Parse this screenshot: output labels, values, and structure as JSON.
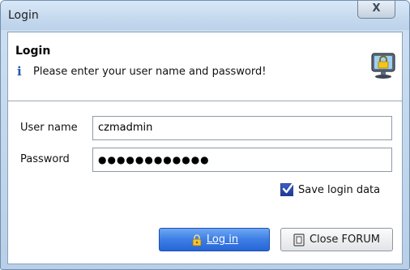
{
  "window": {
    "title": "Login",
    "close_label": "X"
  },
  "header": {
    "title": "Login",
    "info_text": "Please enter your user name and password!",
    "info_icon": "i"
  },
  "form": {
    "username_label": "User name",
    "username_value": "czmadmin",
    "password_label": "Password",
    "password_value": "●●●●●●●●●●●●",
    "save_label": "Save login data",
    "save_checked": true
  },
  "buttons": {
    "login_label": "Log in",
    "close_label": "Close FORUM"
  },
  "colors": {
    "accent": "#3d7ee6",
    "info_icon": "#2a56a8",
    "checkbox": "#1c3a97"
  },
  "icons": [
    "close-icon",
    "info-icon",
    "lock-monitor-icon",
    "check-icon",
    "lock-key-icon",
    "exit-icon"
  ]
}
